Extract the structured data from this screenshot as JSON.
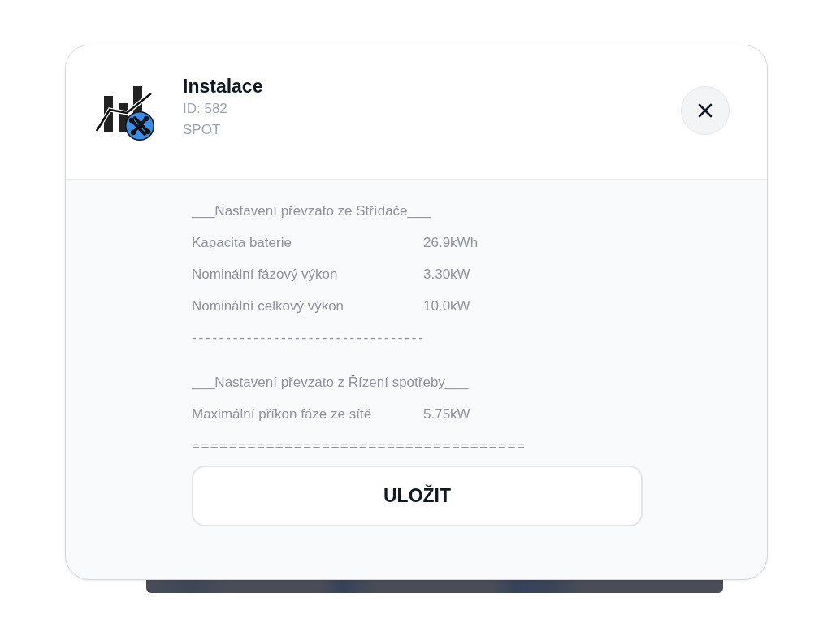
{
  "dialog": {
    "title": "Instalace",
    "id_text": "ID: 582",
    "subtitle": "SPOT"
  },
  "lines": [
    {
      "kind": "heading",
      "text": "___Nastavení převzato ze Střídače___"
    },
    {
      "kind": "field",
      "label": "Kapacita baterie",
      "value": "26.9kWh"
    },
    {
      "kind": "field",
      "label": "Nominální fázový výkon",
      "value": "3.30kW"
    },
    {
      "kind": "field",
      "label": "Nominální celkový výkon",
      "value": "10.0kW"
    },
    {
      "kind": "separator",
      "text": "----------------------------------"
    },
    {
      "kind": "heading",
      "text": "___Nastavení převzato z Řízení spotřeby___"
    },
    {
      "kind": "field",
      "label": "Maximální příkon fáze ze sítě",
      "value": "5.75kW"
    },
    {
      "kind": "separator",
      "text": "===================================="
    }
  ],
  "save_button": {
    "label": "ULOŽIT"
  }
}
